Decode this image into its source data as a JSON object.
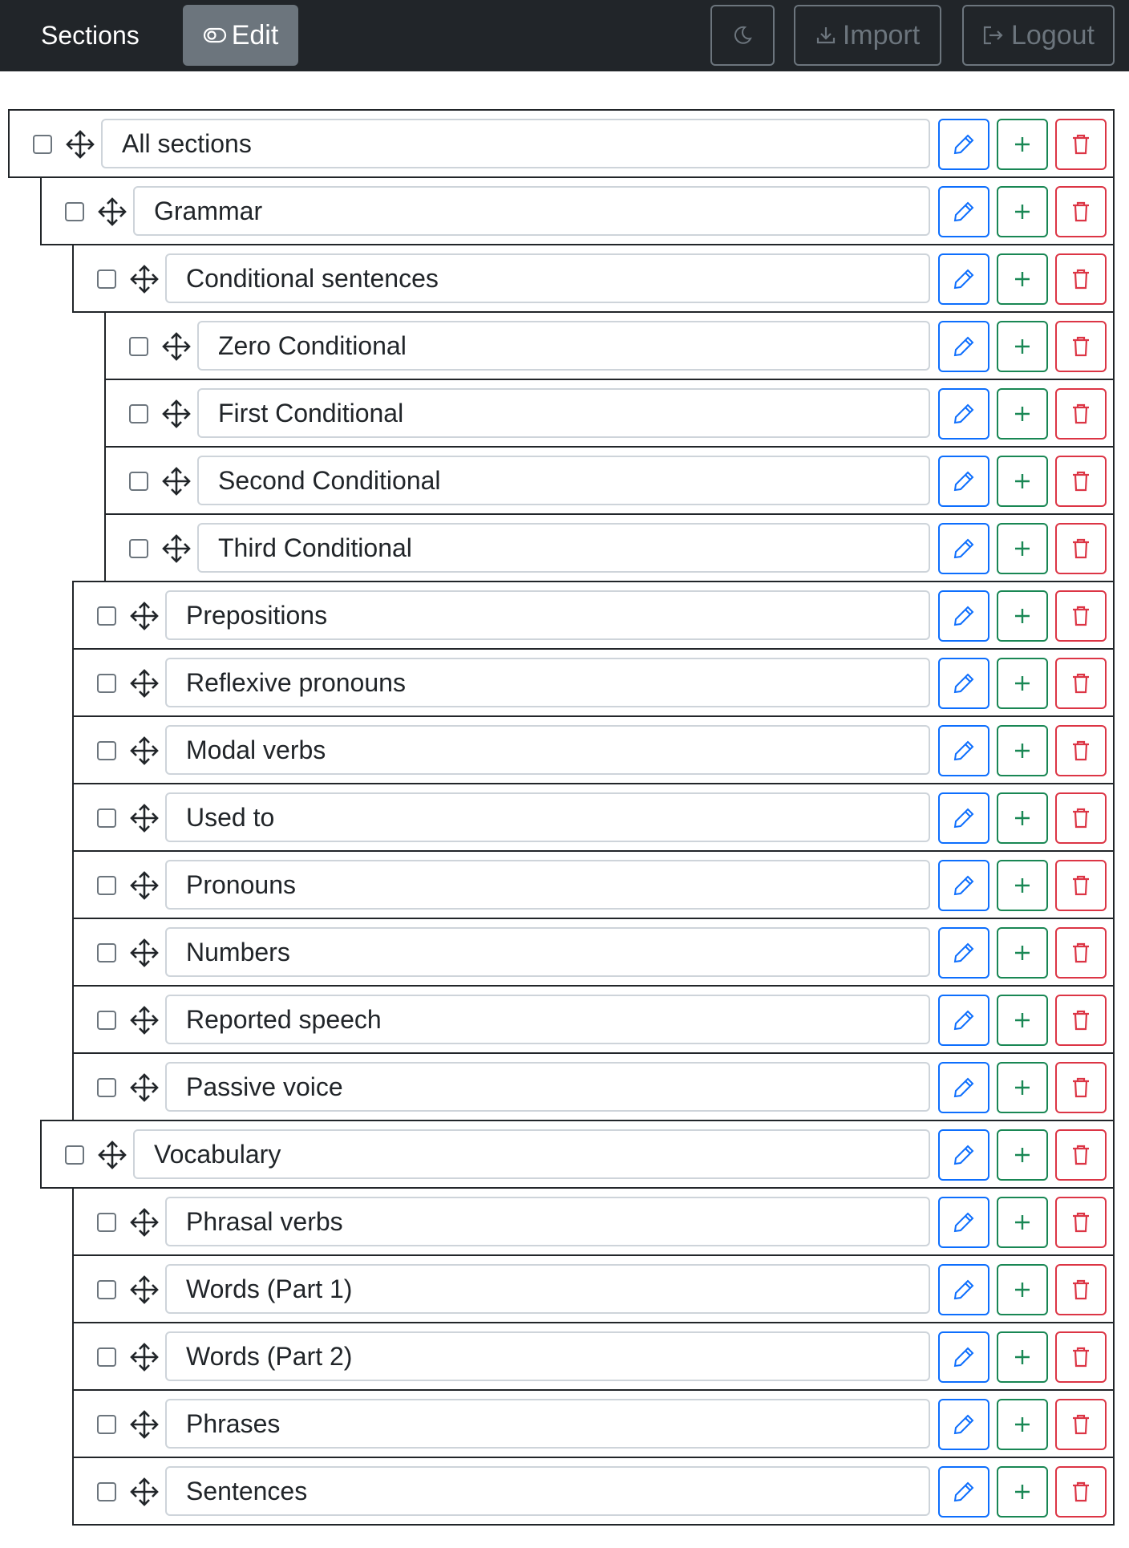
{
  "navbar": {
    "brand": "Sections",
    "edit_label": "Edit",
    "import_label": "Import",
    "logout_label": "Logout"
  },
  "colors": {
    "navbar_bg": "#212529",
    "edit_btn_bg": "#6c757d",
    "action_edit": "#0d6efd",
    "action_add": "#198754",
    "action_delete": "#dc3545"
  },
  "sections": [
    {
      "label": "All sections",
      "depth": 0
    },
    {
      "label": "Grammar",
      "depth": 1
    },
    {
      "label": "Conditional sentences",
      "depth": 2
    },
    {
      "label": "Zero Conditional",
      "depth": 3
    },
    {
      "label": "First Conditional",
      "depth": 3
    },
    {
      "label": "Second Conditional",
      "depth": 3
    },
    {
      "label": "Third Conditional",
      "depth": 3
    },
    {
      "label": "Prepositions",
      "depth": 2
    },
    {
      "label": "Reflexive pronouns",
      "depth": 2
    },
    {
      "label": "Modal verbs",
      "depth": 2
    },
    {
      "label": "Used to",
      "depth": 2
    },
    {
      "label": "Pronouns",
      "depth": 2
    },
    {
      "label": "Numbers",
      "depth": 2
    },
    {
      "label": "Reported speech",
      "depth": 2
    },
    {
      "label": "Passive voice",
      "depth": 2
    },
    {
      "label": "Vocabulary",
      "depth": 1
    },
    {
      "label": "Phrasal verbs",
      "depth": 2
    },
    {
      "label": "Words (Part 1)",
      "depth": 2
    },
    {
      "label": "Words (Part 2)",
      "depth": 2
    },
    {
      "label": "Phrases",
      "depth": 2
    },
    {
      "label": "Sentences",
      "depth": 2
    }
  ]
}
